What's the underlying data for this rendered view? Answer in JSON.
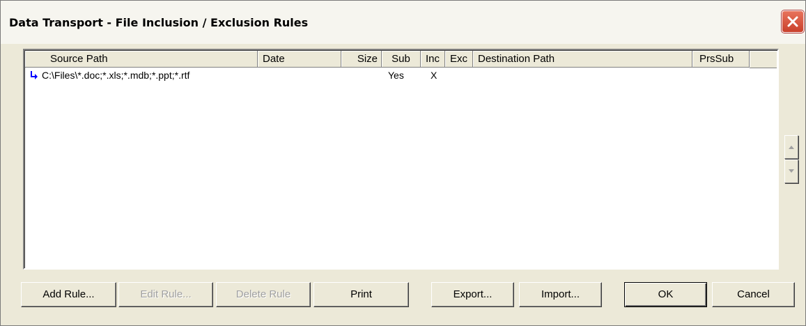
{
  "window": {
    "title": "Data Transport - File Inclusion / Exclusion Rules"
  },
  "list": {
    "columns": [
      "Source Path",
      "Date",
      "Size",
      "Sub",
      "Inc",
      "Exc",
      "Destination Path",
      "PrsSub"
    ],
    "rows": [
      {
        "source_path": "C:\\Files\\*.doc;*.xls;*.mdb;*.ppt;*.rtf",
        "date": "",
        "size": "",
        "sub": "Yes",
        "inc": "X",
        "exc": "",
        "destination_path": "",
        "prssub": "",
        "icon": "arrow-right-icon"
      }
    ]
  },
  "buttons": {
    "add_rule": "Add Rule...",
    "edit_rule": "Edit Rule...",
    "delete_rule": "Delete Rule",
    "print": "Print",
    "export": "Export...",
    "import": "Import...",
    "ok": "OK",
    "cancel": "Cancel"
  },
  "colors": {
    "accent": "#0000ff",
    "face": "#ece9d8",
    "close": "#c9402b"
  }
}
